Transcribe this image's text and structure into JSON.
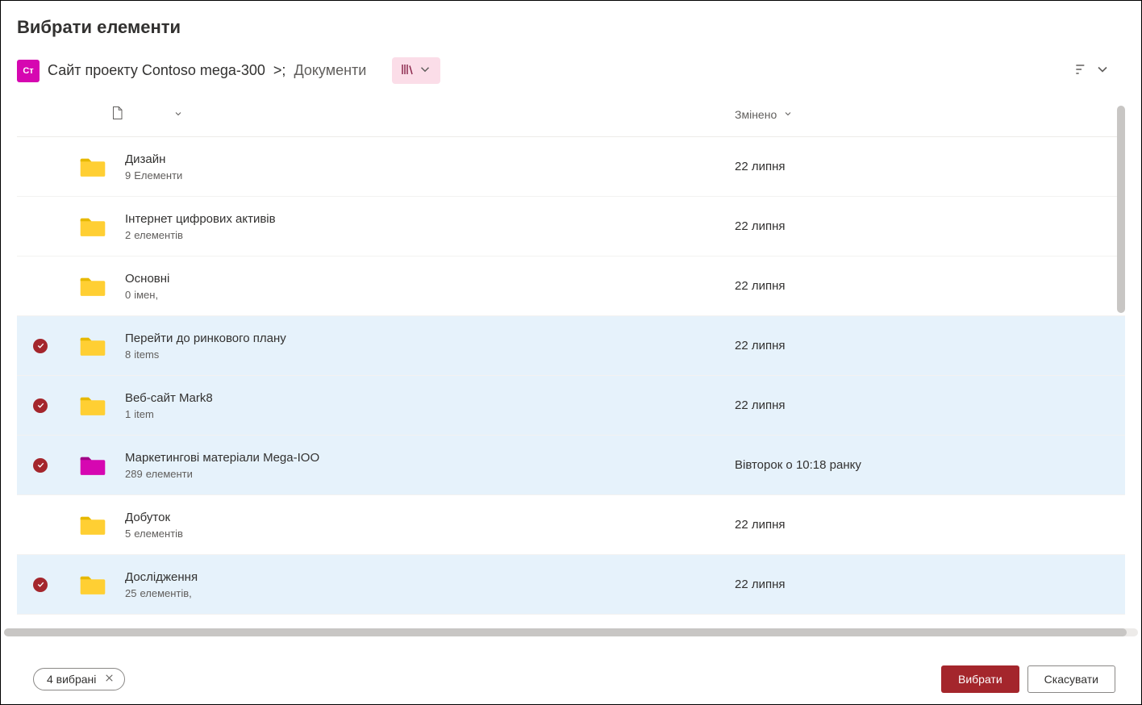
{
  "dialog": {
    "title": "Вибрати елементи"
  },
  "breadcrumb": {
    "site_initials": "Ст",
    "site_name": "Сайт проекту Contoso mega-300",
    "separator": ">;",
    "current": "Документи"
  },
  "columns": {
    "modified": "Змінено"
  },
  "items": [
    {
      "name": "Дизайн",
      "count": "9",
      "count_label": "Елементи",
      "modified": "22 липня",
      "selected": false,
      "color": "yellow"
    },
    {
      "name": "Інтернет цифрових активів",
      "count": "2",
      "count_label": "елементів",
      "modified": "22 липня",
      "selected": false,
      "color": "yellow"
    },
    {
      "name": "Основні",
      "count": "0",
      "count_label": "імен,",
      "modified": "22 липня",
      "selected": false,
      "color": "yellow"
    },
    {
      "name": "Перейти до ринкового плану",
      "count": "8",
      "count_label": "items",
      "modified": "22 липня",
      "selected": true,
      "color": "yellow"
    },
    {
      "name": "Веб-сайт Mark8",
      "count": "1",
      "count_label": "item",
      "modified": "22 липня",
      "selected": true,
      "color": "yellow"
    },
    {
      "name": "Маркетингові матеріали Mega-IOO",
      "count": "289",
      "count_label": "елементи",
      "modified": "Вівторок о 10:18 ранку",
      "selected": true,
      "color": "pink"
    },
    {
      "name": "Добуток",
      "count": "5",
      "count_label": "елементів",
      "modified": "22 липня",
      "selected": false,
      "color": "yellow"
    },
    {
      "name": "Дослідження",
      "count": "25",
      "count_label": "елементів,",
      "modified": "22 липня",
      "selected": true,
      "color": "yellow"
    }
  ],
  "footer": {
    "selection_count_label": "4 вибрані",
    "select_button": "Вибрати",
    "cancel_button": "Скасувати"
  }
}
